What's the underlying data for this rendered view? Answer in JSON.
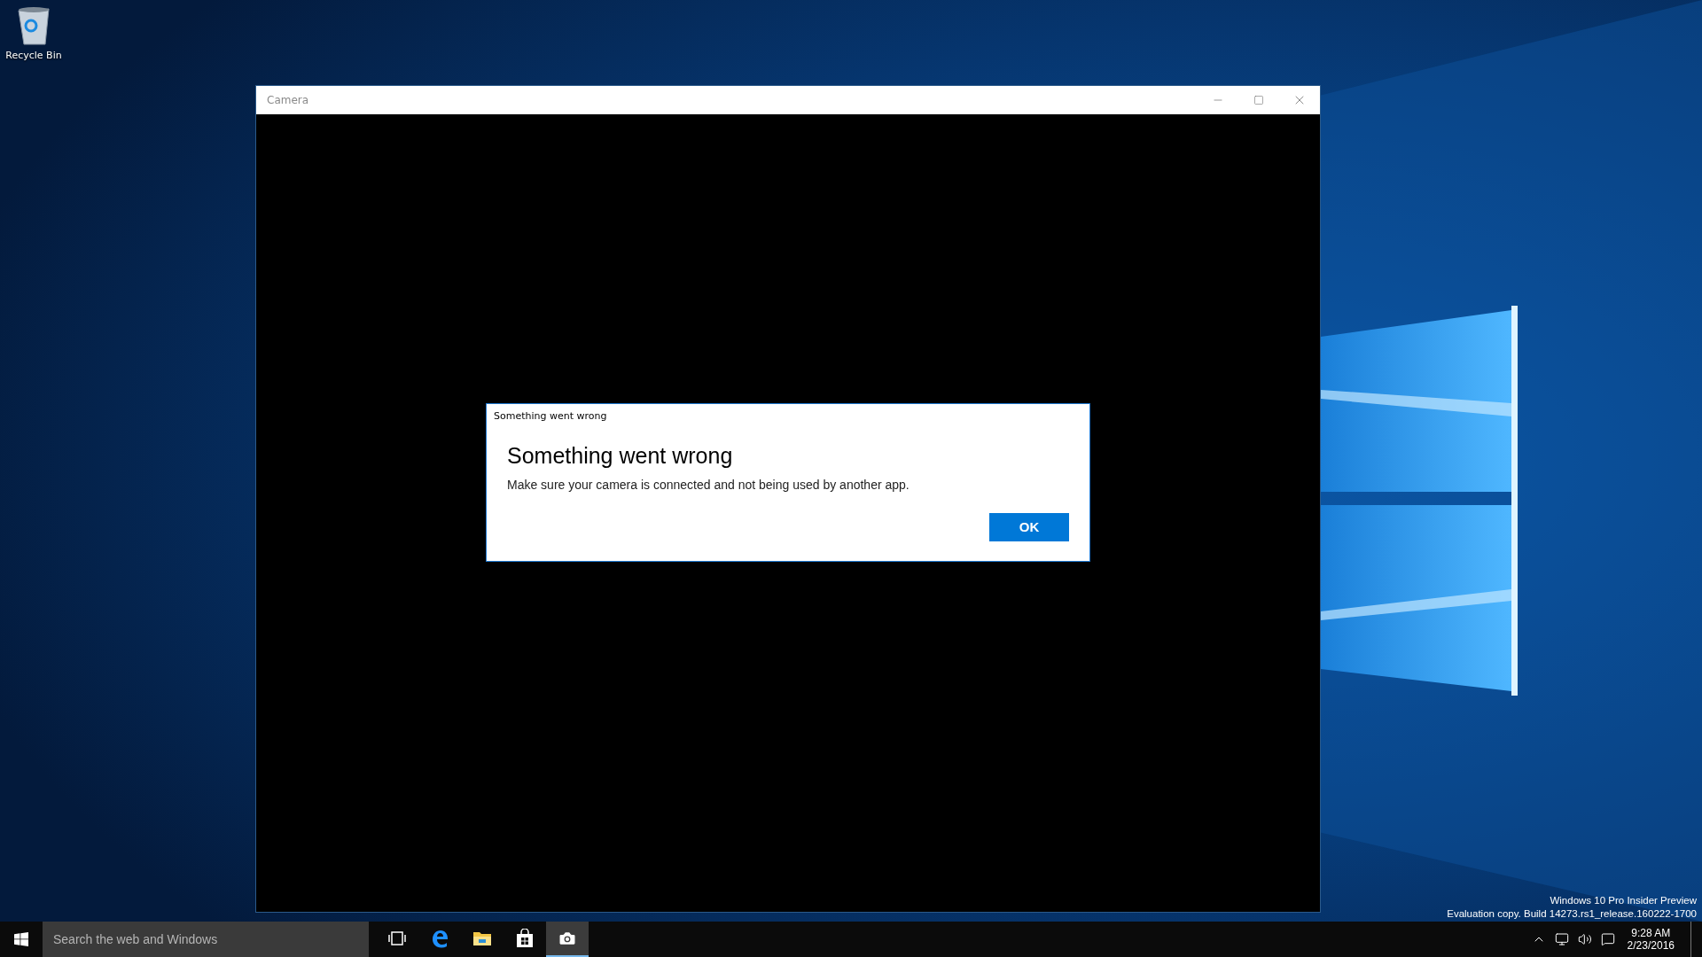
{
  "desktop_icons": [
    {
      "label": "Recycle Bin"
    }
  ],
  "window": {
    "title": "Camera",
    "dialog": {
      "caption": "Something went wrong",
      "heading": "Something went wrong",
      "message": "Make sure your camera is connected and not being used by another app.",
      "button": "OK"
    }
  },
  "desktop_text": [
    "Windows 10 Pro Insider Preview",
    "Evaluation copy. Build 14273.rs1_release.160222-1700"
  ],
  "taskbar": {
    "search": {
      "placeholder": "Search the web and Windows"
    },
    "apps": [
      {
        "kind": "task-view",
        "selected": false
      },
      {
        "kind": "edge",
        "selected": false
      },
      {
        "kind": "explorer",
        "selected": false
      },
      {
        "kind": "store",
        "selected": false
      },
      {
        "kind": "camera",
        "selected": true
      }
    ],
    "clock": {
      "time": "9:28 AM",
      "date": "2/23/2016"
    }
  }
}
